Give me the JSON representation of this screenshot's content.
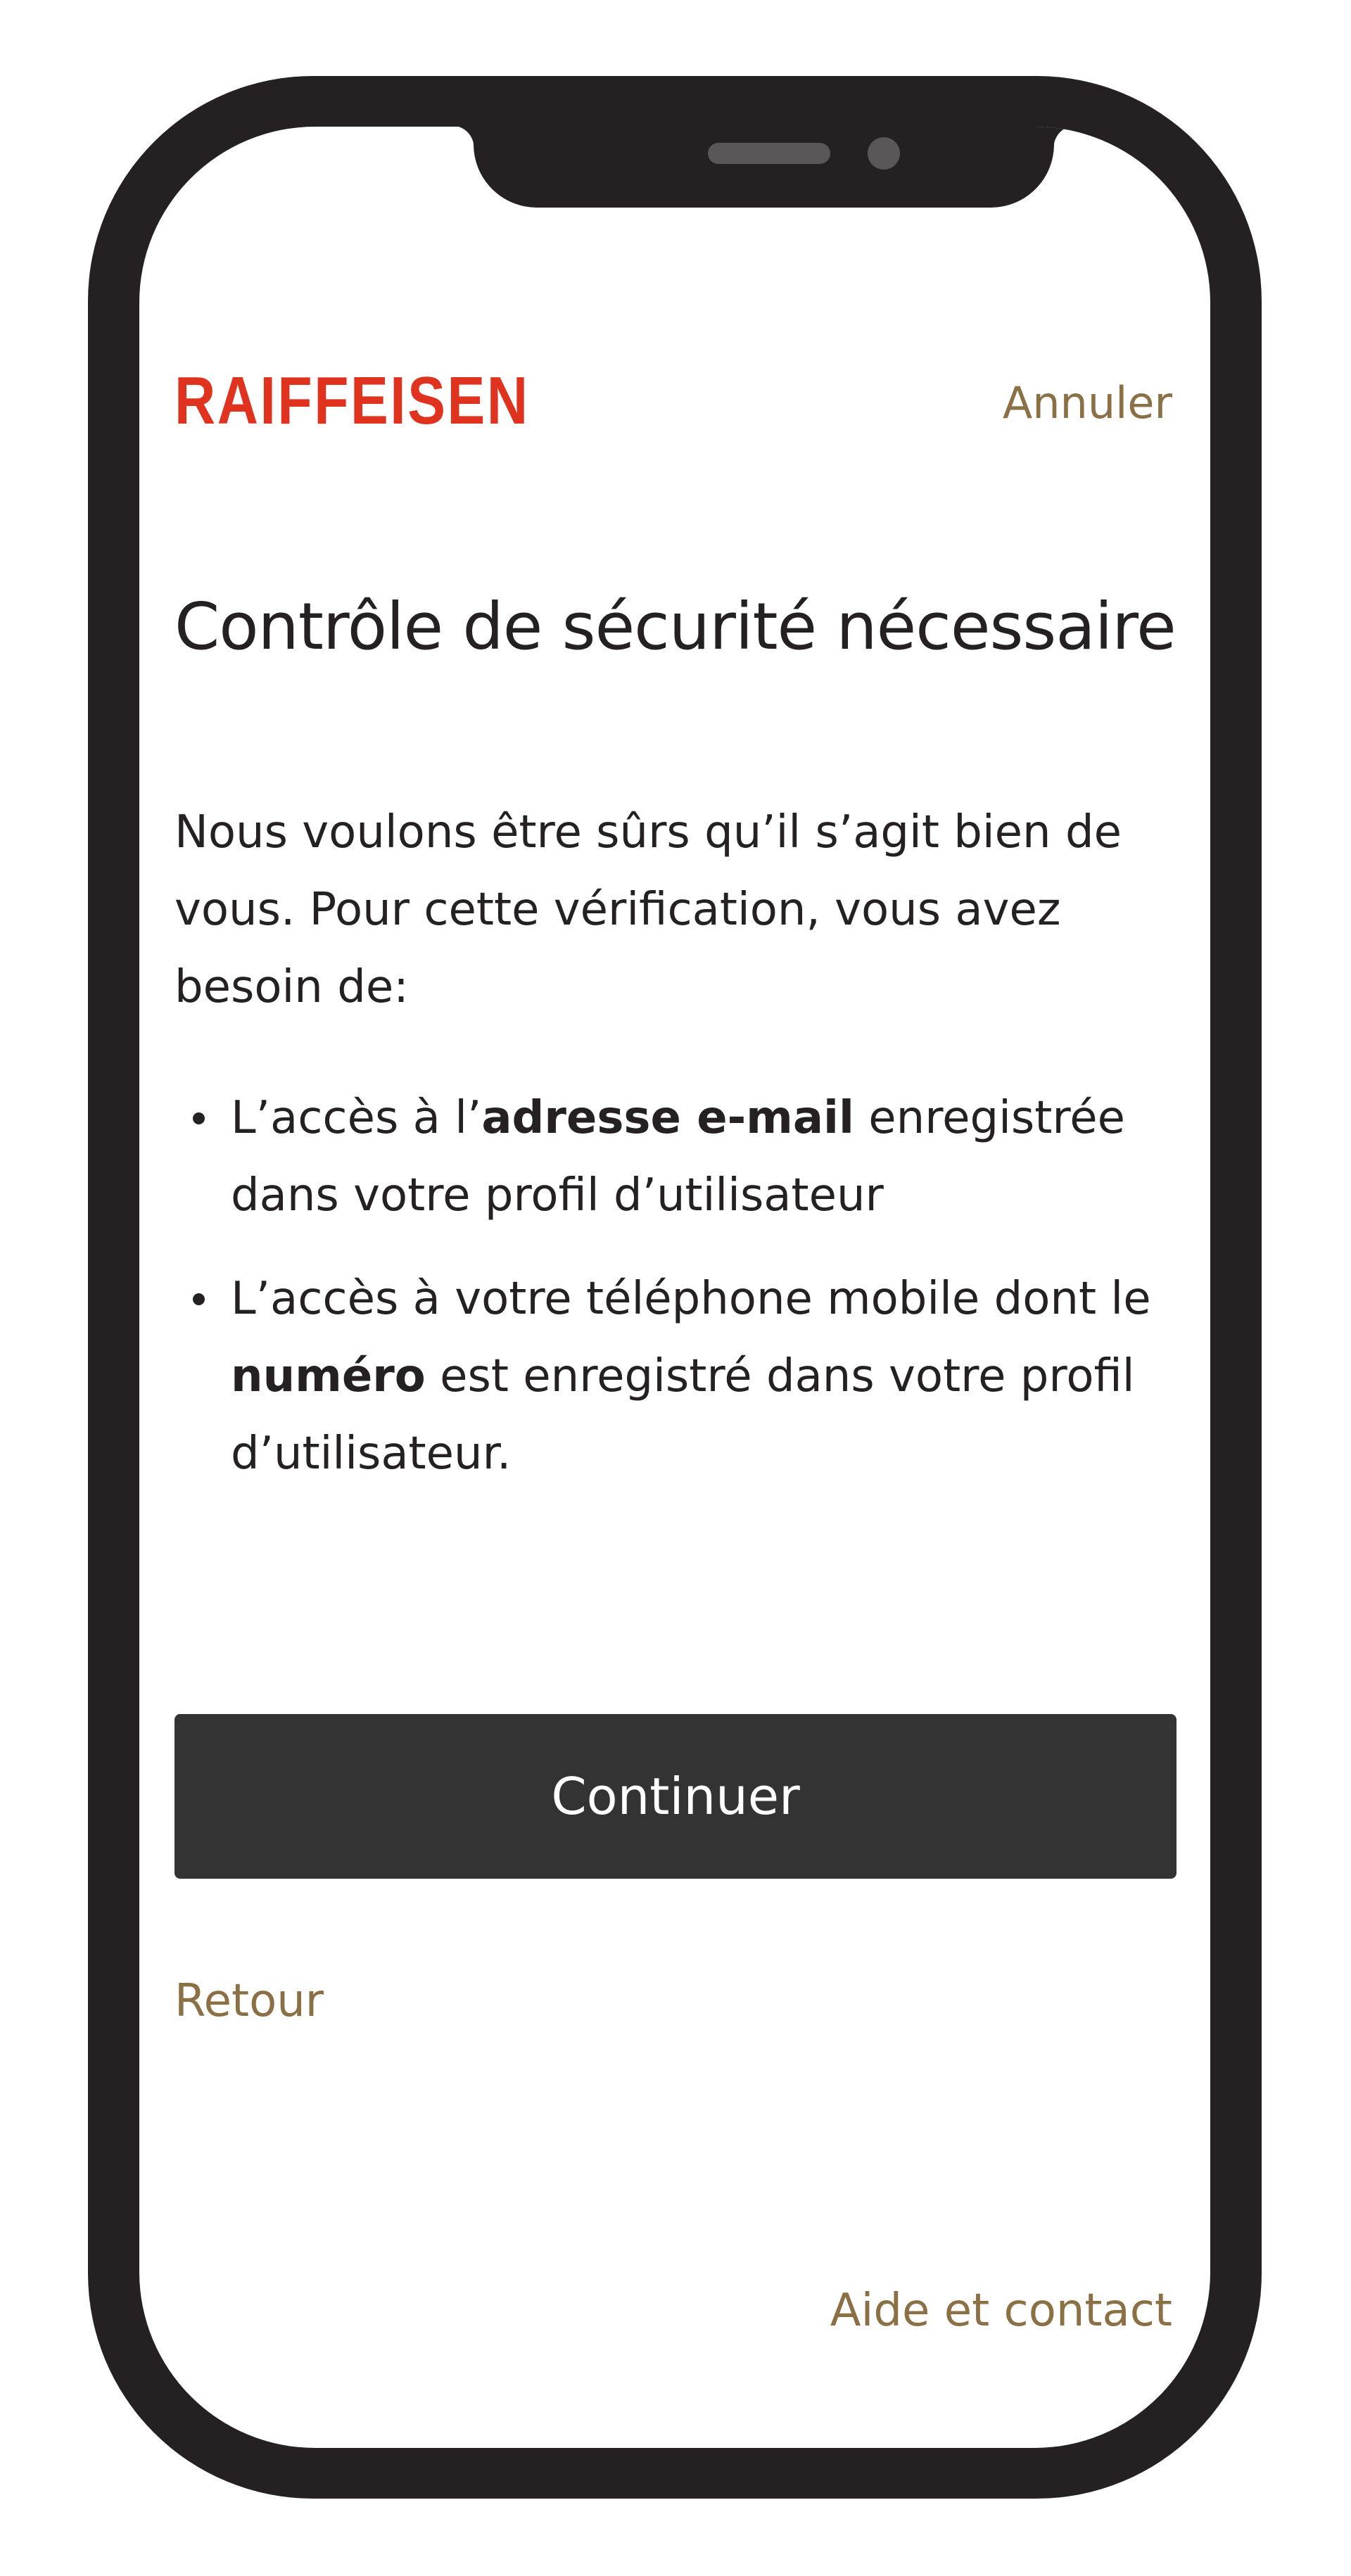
{
  "header": {
    "logo_text": "RAIFFEISEN",
    "cancel_label": "Annuler"
  },
  "main": {
    "title": "Contrôle de sécurité nécessaire",
    "intro": "Nous voulons être sûrs qu’il s’agit bien de vous. Pour cette vérification, vous avez besoin de:",
    "requirements": [
      {
        "before": "L’accès à l’",
        "bold": "adresse e-mail",
        "after": " enregistrée dans votre profil d’utilisateur"
      },
      {
        "before": "L’accès à votre téléphone mobile dont le ",
        "bold": "numéro",
        "after": " est enregistré dans votre profil d’utilisateur."
      }
    ],
    "continue_label": "Continuer",
    "back_label": "Retour"
  },
  "footer": {
    "help_label": "Aide et contact"
  },
  "colors": {
    "brand_red": "#e0331f",
    "link_gold": "#8b7046",
    "button_bg": "#333333",
    "text": "#252122",
    "phone_frame": "#252122"
  },
  "icons": [
    "phone-speaker-icon",
    "phone-camera-icon",
    "bullet-icon"
  ]
}
